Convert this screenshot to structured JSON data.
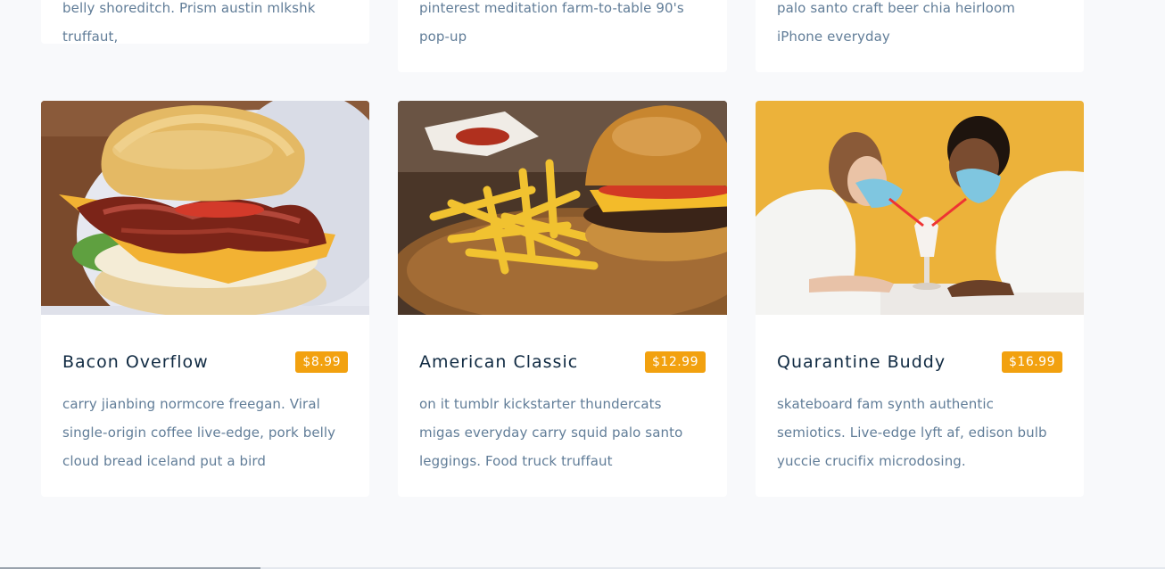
{
  "top_row": [
    {
      "text": "belly shoreditch. Prism austin mlkshk truffaut,"
    },
    {
      "text": "pinterest meditation farm-to-table 90's pop-up"
    },
    {
      "text": "palo santo craft beer chia heirloom iPhone everyday"
    }
  ],
  "menu_items": [
    {
      "title": "Bacon Overflow",
      "price": "$8.99",
      "description": "carry jianbing normcore freegan. Viral single-origin coffee live-edge, pork belly cloud bread iceland put a bird",
      "image": "bacon-biscuit-sandwich-photo"
    },
    {
      "title": "American Classic",
      "price": "$12.99",
      "description": "on it tumblr kickstarter thundercats migas everyday carry squid palo santo leggings. Food truck truffaut",
      "image": "burger-and-fries-photo"
    },
    {
      "title": "Quarantine Buddy",
      "price": "$16.99",
      "description": "skateboard fam synth authentic semiotics. Live-edge lyft af, edison bulb yuccie crucifix microdosing.",
      "image": "couple-sharing-milkshake-photo"
    }
  ],
  "colors": {
    "page_background": "#f8f9fb",
    "card_background": "#ffffff",
    "title": "#102a42",
    "body_text": "#617d98",
    "price_badge": "#f2a10f"
  }
}
